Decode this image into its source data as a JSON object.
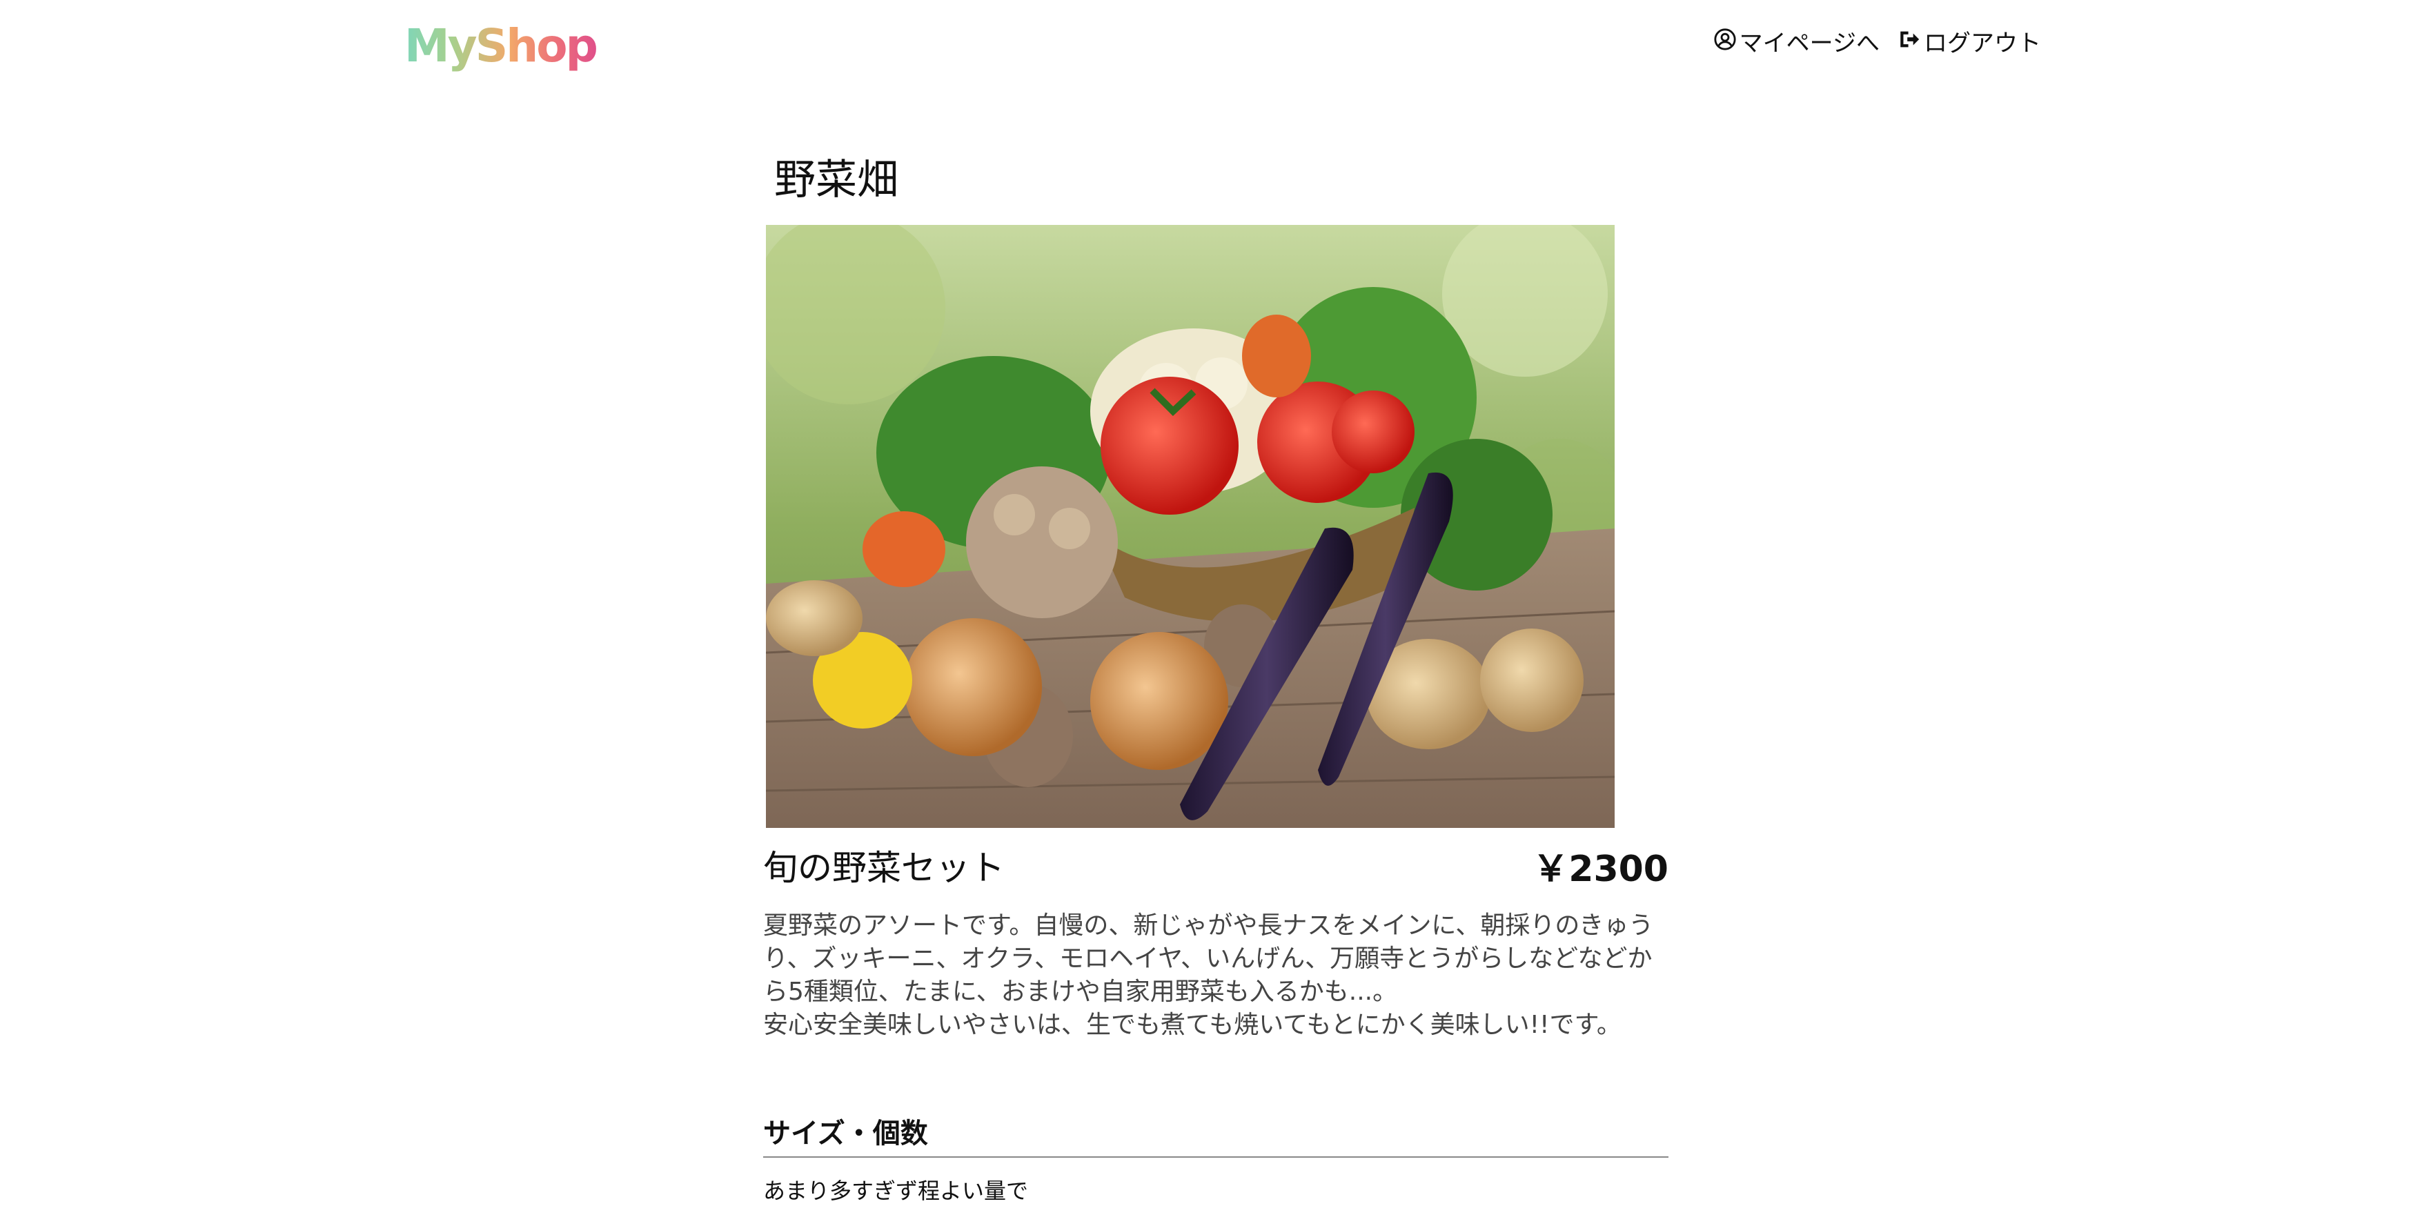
{
  "header": {
    "logo": "MyShop",
    "nav": {
      "mypage_label": "マイページへ",
      "logout_label": "ログアウト"
    }
  },
  "page": {
    "title": "野菜畑"
  },
  "product": {
    "image_icon": "vegetable-basket-photo",
    "name": "旬の野菜セット",
    "price": "￥2300",
    "description": [
      "夏野菜のアソートです。自慢の、新じゃがや長ナスをメインに、朝採りのきゅうり、ズッキーニ、オクラ、モロヘイヤ、いんげん、万願寺とうがらしなどなどから5種類位、たまに、おまけや自家用野菜も入るかも...。",
      "安心安全美味しいやさいは、生でも煮ても焼いてもとにかく美味しい!!です。"
    ]
  },
  "sections": {
    "size_heading": "サイズ・個数",
    "size_text": "あまり多すぎず程よい量で"
  },
  "colors": {
    "logo_gradient_start": "#7fd6b8",
    "logo_gradient_end": "#e0508a",
    "description_text": "#444444"
  }
}
